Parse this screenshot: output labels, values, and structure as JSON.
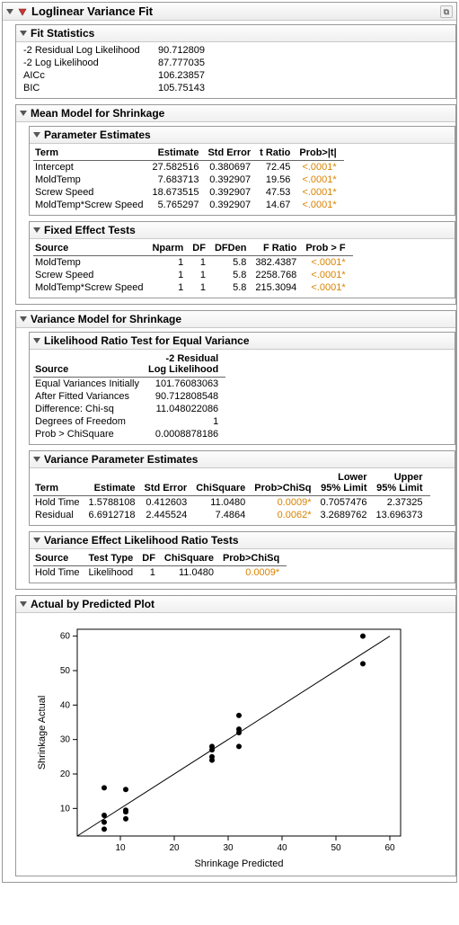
{
  "main_title": "Loglinear Variance Fit",
  "fit_stats": {
    "title": "Fit Statistics",
    "rows": [
      {
        "k": "-2 Residual Log Likelihood",
        "v": "90.712809"
      },
      {
        "k": "-2 Log Likelihood",
        "v": "87.777035"
      },
      {
        "k": "AICc",
        "v": "106.23857"
      },
      {
        "k": "BIC",
        "v": "105.75143"
      }
    ]
  },
  "mean_model": {
    "title": "Mean Model for Shrinkage",
    "param_est": {
      "title": "Parameter Estimates",
      "headers": [
        "Term",
        "Estimate",
        "Std Error",
        "t Ratio",
        "Prob>|t|"
      ],
      "rows": [
        {
          "term": "Intercept",
          "est": "27.582516",
          "se": "0.380697",
          "t": "72.45",
          "p": "<.0001*"
        },
        {
          "term": "MoldTemp",
          "est": "7.683713",
          "se": "0.392907",
          "t": "19.56",
          "p": "<.0001*"
        },
        {
          "term": "Screw Speed",
          "est": "18.673515",
          "se": "0.392907",
          "t": "47.53",
          "p": "<.0001*"
        },
        {
          "term": "MoldTemp*Screw Speed",
          "est": "5.765297",
          "se": "0.392907",
          "t": "14.67",
          "p": "<.0001*"
        }
      ]
    },
    "fixed_tests": {
      "title": "Fixed Effect Tests",
      "headers": [
        "Source",
        "Nparm",
        "DF",
        "DFDen",
        "F Ratio",
        "Prob > F"
      ],
      "rows": [
        {
          "src": "MoldTemp",
          "np": "1",
          "df": "1",
          "dfd": "5.8",
          "f": "382.4387",
          "p": "<.0001*"
        },
        {
          "src": "Screw Speed",
          "np": "1",
          "df": "1",
          "dfd": "5.8",
          "f": "2258.768",
          "p": "<.0001*"
        },
        {
          "src": "MoldTemp*Screw Speed",
          "np": "1",
          "df": "1",
          "dfd": "5.8",
          "f": "215.3094",
          "p": "<.0001*"
        }
      ]
    }
  },
  "var_model": {
    "title": "Variance Model for Shrinkage",
    "lr_test": {
      "title": "Likelihood Ratio Test for Equal Variance",
      "header2": "-2 Residual\nLog Likelihood",
      "header1": "Source",
      "rows": [
        {
          "k": "Equal Variances Initially",
          "v": "101.76083063"
        },
        {
          "k": "After Fitted Variances",
          "v": "90.712808548"
        },
        {
          "k": "Difference: Chi-sq",
          "v": "11.048022086"
        },
        {
          "k": "Degrees of Freedom",
          "v": "1"
        },
        {
          "k": "Prob > ChiSquare",
          "v": "0.0008878186"
        }
      ]
    },
    "var_param": {
      "title": "Variance Parameter Estimates",
      "headers": [
        "Term",
        "Estimate",
        "Std Error",
        "ChiSquare",
        "Prob>ChiSq",
        "Lower 95% Limit",
        "Upper 95% Limit"
      ],
      "rows": [
        {
          "term": "Hold Time",
          "est": "1.5788108",
          "se": "0.412603",
          "chi": "11.0480",
          "p": "0.0009*",
          "lo": "0.7057476",
          "hi": "2.37325"
        },
        {
          "term": "Residual",
          "est": "6.6912718",
          "se": "2.445524",
          "chi": "7.4864",
          "p": "0.0062*",
          "lo": "3.2689762",
          "hi": "13.696373"
        }
      ]
    },
    "var_effect": {
      "title": "Variance Effect Likelihood Ratio Tests",
      "headers": [
        "Source",
        "Test Type",
        "DF",
        "ChiSquare",
        "Prob>ChiSq"
      ],
      "rows": [
        {
          "src": "Hold Time",
          "tt": "Likelihood",
          "df": "1",
          "chi": "11.0480",
          "p": "0.0009*"
        }
      ]
    }
  },
  "plot": {
    "title": "Actual by Predicted Plot",
    "xlabel": "Shrinkage Predicted",
    "ylabel": "Shrinkage Actual"
  },
  "chart_data": {
    "type": "scatter",
    "xlabel": "Shrinkage Predicted",
    "ylabel": "Shrinkage Actual",
    "xlim": [
      2,
      62
    ],
    "ylim": [
      2,
      62
    ],
    "xticks": [
      10,
      20,
      30,
      40,
      50,
      60
    ],
    "yticks": [
      10,
      20,
      30,
      40,
      50,
      60
    ],
    "reference_line": {
      "x0": 2,
      "y0": 2,
      "x1": 60,
      "y1": 60
    },
    "points": [
      {
        "x": 7,
        "y": 4
      },
      {
        "x": 7,
        "y": 6
      },
      {
        "x": 7,
        "y": 8
      },
      {
        "x": 7,
        "y": 16
      },
      {
        "x": 11,
        "y": 7
      },
      {
        "x": 11,
        "y": 9
      },
      {
        "x": 11,
        "y": 9.5
      },
      {
        "x": 11,
        "y": 15.5
      },
      {
        "x": 27,
        "y": 24
      },
      {
        "x": 27,
        "y": 25
      },
      {
        "x": 27,
        "y": 27
      },
      {
        "x": 27,
        "y": 28
      },
      {
        "x": 32,
        "y": 28
      },
      {
        "x": 32,
        "y": 32
      },
      {
        "x": 32,
        "y": 33
      },
      {
        "x": 32,
        "y": 37
      },
      {
        "x": 55,
        "y": 52
      },
      {
        "x": 55,
        "y": 60
      }
    ]
  }
}
